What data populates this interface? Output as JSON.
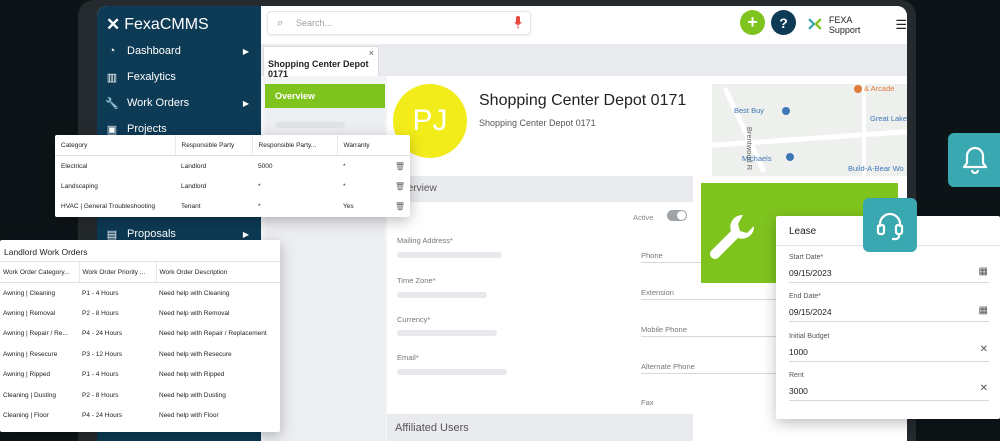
{
  "sidebar": {
    "logo": "FexaCMMS",
    "items": [
      {
        "label": "Dashboard",
        "icon": "dashboard-icon"
      },
      {
        "label": "Fexalytics",
        "icon": "chart-icon"
      },
      {
        "label": "Work Orders",
        "icon": "wrench-icon"
      },
      {
        "label": "Projects",
        "icon": "briefcase-icon"
      },
      {
        "label": "Proposals",
        "icon": "clipboard-icon"
      }
    ]
  },
  "topbar": {
    "search_placeholder": "Search...",
    "add_label": "+",
    "help_label": "?",
    "support_label": "FEXA Support"
  },
  "tab": {
    "label": "Shopping Center Depot 0171",
    "close": "×"
  },
  "subnav": {
    "active": "Overview"
  },
  "profile": {
    "initials": "PJ",
    "title": "Shopping Center Depot 0171",
    "subtitle": "Shopping Center Depot 0171"
  },
  "map": {
    "labels": [
      "Best Buy",
      "Michaels",
      "Great Lakes",
      "Build-A-Bear Wo",
      "& Arcade",
      "Brentwood R"
    ],
    "accent": "#3e77b8"
  },
  "overview": {
    "section_title": "Overview",
    "active_label": "Active",
    "fields_left": [
      "Mailing Address*",
      "Time Zone*",
      "Currency*",
      "Email*"
    ],
    "fields_right": [
      "Phone",
      "Extension",
      "Mobile Phone",
      "Alternate Phone",
      "Fax"
    ],
    "affiliated_title": "Affiliated Users"
  },
  "warranty_table": {
    "headers": [
      "Category",
      "Responsible Party",
      "Responsible Party...",
      "Warranty"
    ],
    "rows": [
      [
        "Electrical",
        "Landlord",
        "5000",
        "*"
      ],
      [
        "Landscaping",
        "Landlord",
        "*",
        "*"
      ],
      [
        "HVAC | General Troubleshooting",
        "Tenant",
        "*",
        "Yes"
      ]
    ]
  },
  "landlord_table": {
    "title": "Landlord Work Orders",
    "headers": [
      "Work Order Category...",
      "Work Order Priority ...",
      "Work Order Description"
    ],
    "rows": [
      [
        "Awning | Cleaning",
        "P1 - 4 Hours",
        "Need help with Cleaning"
      ],
      [
        "Awning | Removal",
        "P2 - 8 Hours",
        "Need help with Removal"
      ],
      [
        "Awning | Repair / Re...",
        "P4 - 24 Hours",
        "Need help with Repair / Replacement"
      ],
      [
        "Awning | Resecure",
        "P3 - 12 Hours",
        "Need help with Resecure"
      ],
      [
        "Awning | Ripped",
        "P1 - 4 Hours",
        "Need help with Ripped"
      ],
      [
        "Cleaning | Dusting",
        "P2 - 8 Hours",
        "Need help with Dusting"
      ],
      [
        "Cleaning | Floor",
        "P4 - 24 Hours",
        "Need help with Floor"
      ]
    ]
  },
  "lease": {
    "title": "Lease",
    "start_label": "Start Date*",
    "start_value": "09/15/2023",
    "end_label": "End Date*",
    "end_value": "09/15/2024",
    "budget_label": "Initial Budget",
    "budget_value": "1000",
    "rent_label": "Rent",
    "rent_value": "3000"
  },
  "colors": {
    "brand_navy": "#0d3a55",
    "brand_green": "#7fc41e",
    "teal": "#3aa8b0",
    "avatar_yellow": "#f2ec1a"
  }
}
